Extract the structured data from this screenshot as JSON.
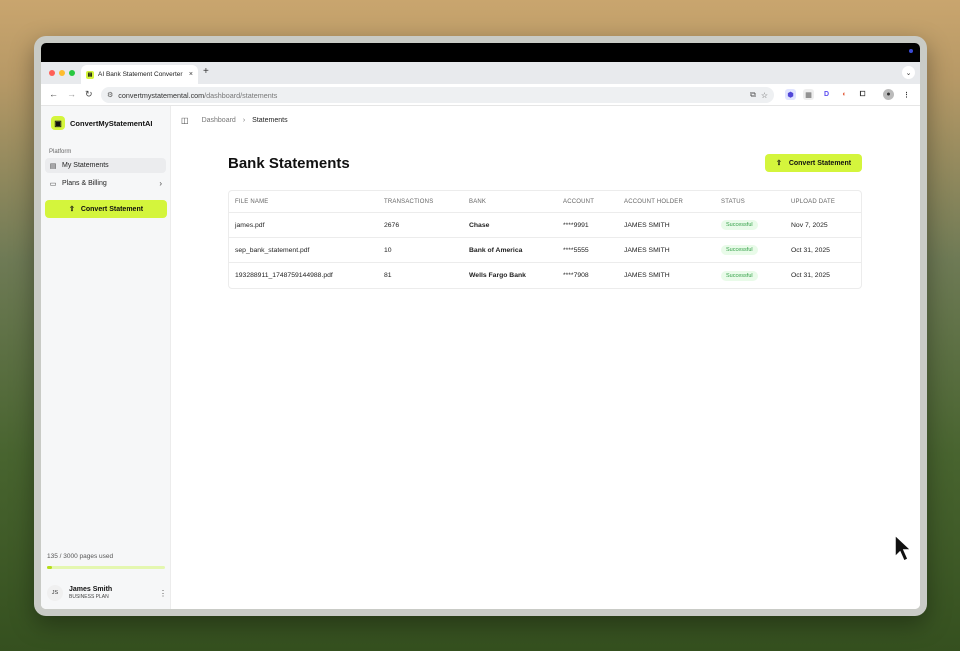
{
  "browser": {
    "tab_title": "AI Bank Statement Converter",
    "tab_close": "×",
    "new_tab": "+",
    "url_domain": "convertmystatemental.com",
    "url_path": "/dashboard/statements"
  },
  "sidebar": {
    "brand": "ConvertMyStatementAI",
    "section_label": "Platform",
    "items": [
      {
        "label": "My Statements",
        "icon": "document-icon"
      },
      {
        "label": "Plans & Billing",
        "icon": "card-icon"
      }
    ],
    "convert_label": "Convert Statement",
    "usage_text": "135 / 3000 pages used",
    "usage_fraction": 0.045,
    "user": {
      "initials": "JS",
      "name": "James Smith",
      "plan": "BUSINESS PLAN"
    }
  },
  "breadcrumb": {
    "parent": "Dashboard",
    "current": "Statements"
  },
  "page": {
    "title": "Bank Statements",
    "convert_label": "Convert Statement"
  },
  "table": {
    "columns": [
      "FILE NAME",
      "TRANSACTIONS",
      "BANK",
      "ACCOUNT",
      "ACCOUNT HOLDER",
      "STATUS",
      "UPLOAD DATE"
    ],
    "rows": [
      {
        "file": "james.pdf",
        "tx": "2676",
        "bank": "Chase",
        "account": "****9991",
        "holder": "JAMES SMITH",
        "status": "Successful",
        "date": "Nov 7, 2025"
      },
      {
        "file": "sep_bank_statement.pdf",
        "tx": "10",
        "bank": "Bank of America",
        "account": "****5555",
        "holder": "JAMES SMITH",
        "status": "Successful",
        "date": "Oct 31, 2025"
      },
      {
        "file": "193288911_1748759144988.pdf",
        "tx": "81",
        "bank": "Wells Fargo Bank",
        "account": "****7908",
        "holder": "JAMES SMITH",
        "status": "Successful",
        "date": "Oct 31, 2025"
      }
    ]
  },
  "colors": {
    "accent": "#d4f53c",
    "success_text": "#2f9e44",
    "success_bg": "#e9fbe9"
  }
}
